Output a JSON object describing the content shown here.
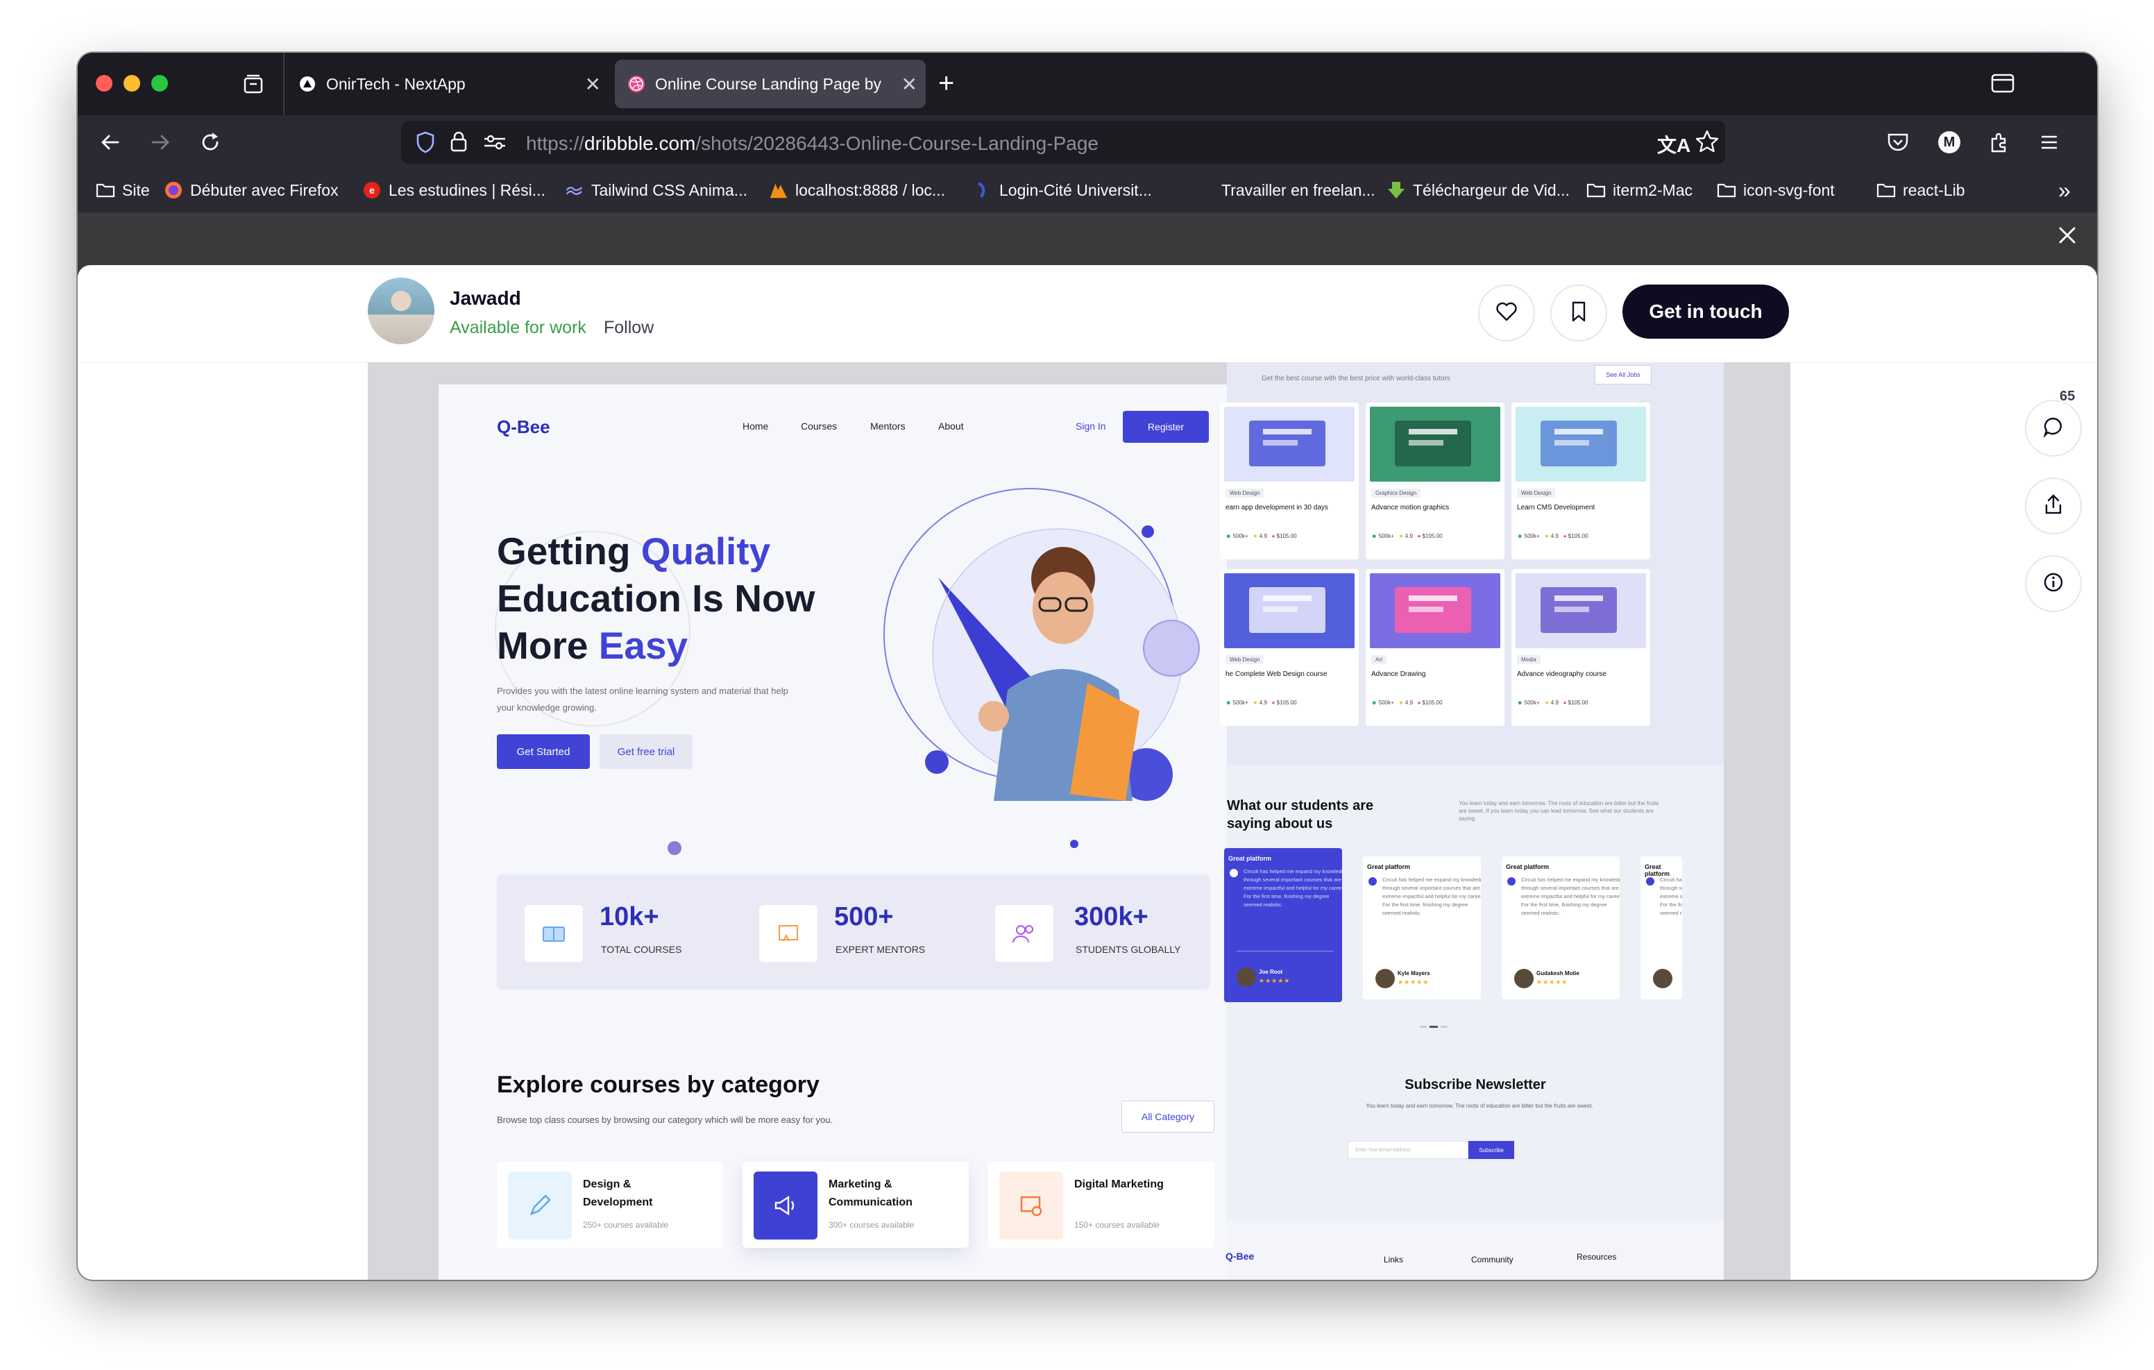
{
  "browser": {
    "tabs": [
      {
        "title": "OnirTech - NextApp",
        "active": false
      },
      {
        "title": "Online Course Landing Page by",
        "active": true
      }
    ],
    "url": {
      "scheme": "https://",
      "domain": "dribbble.com",
      "path": "/shots/20286443-Online-Course-Landing-Page"
    },
    "bookmarks": [
      {
        "label": "Site",
        "icon": "folder-icon"
      },
      {
        "label": "Débuter avec Firefox",
        "icon": "firefox-icon"
      },
      {
        "label": "Les estudines | Rési...",
        "icon": "estudines-icon"
      },
      {
        "label": "Tailwind CSS Anima...",
        "icon": "tailwind-icon"
      },
      {
        "label": "localhost:8888 / loc...",
        "icon": "phpmyadmin-icon"
      },
      {
        "label": "Login-Cité Universit...",
        "icon": "cite-icon"
      },
      {
        "label": "Travailler en freelan...",
        "icon": "malt-icon"
      },
      {
        "label": "Téléchargeur de Vid...",
        "icon": "download-icon"
      },
      {
        "label": "iterm2-Mac",
        "icon": "folder-icon"
      },
      {
        "label": "icon-svg-font",
        "icon": "folder-icon"
      },
      {
        "label": "react-Lib",
        "icon": "folder-icon"
      }
    ],
    "profile_initial": "M"
  },
  "shot_header": {
    "designer": "Jawadd",
    "availability": "Available for work",
    "follow": "Follow",
    "cta": "Get in touch",
    "comment_count": "65"
  },
  "landing": {
    "logo": "Q-Bee",
    "nav": [
      "Home",
      "Courses",
      "Mentors",
      "About"
    ],
    "sign_in": "Sign In",
    "register": "Register",
    "hero": {
      "line1a": "Getting ",
      "line1b": "Quality",
      "line2": "Education Is Now",
      "line3a": "More ",
      "line3b": "Easy",
      "subtitle": "Provides you with the latest online learning system and material that help your knowledge growing.",
      "get_started": "Get Started",
      "free_trial": "Get free trial"
    },
    "stats": [
      {
        "value": "10k+",
        "label": "TOTAL COURSES",
        "icon": "book-icon",
        "color": "#60a5fa"
      },
      {
        "value": "500+",
        "label": "EXPERT MENTORS",
        "icon": "certificate-icon",
        "color": "#f59e42"
      },
      {
        "value": "300k+",
        "label": "STUDENTS GLOBALLY",
        "icon": "users-icon",
        "color": "#a855f7"
      }
    ],
    "categories_title": "Explore courses by category",
    "categories_subtitle": "Browse top class courses by browsing our category which will be more easy for you.",
    "all_category": "All Category",
    "categories": [
      {
        "name": "Design & Development",
        "count": "250+ courses available",
        "icon": "pen-icon",
        "bg": "#e7f3fd",
        "fg": "#5aa7e8"
      },
      {
        "name": "Marketing & Communication",
        "count": "300+ courses available",
        "icon": "megaphone-icon",
        "bg": "#3f41d4",
        "fg": "#ffffff"
      },
      {
        "name": "Digital Marketing",
        "count": "150+ courses available",
        "icon": "marketing-icon",
        "bg": "#fdeee6",
        "fg": "#f07a3c"
      }
    ]
  },
  "right_panel": {
    "subtitle": "Get the best course with the best price with world-class tutors",
    "see_all": "See All Jobs",
    "courses": [
      {
        "tag": "Web Design",
        "title": "earn app development in 30 days",
        "bg": "#dfe3fb",
        "accent": "#4b54d8"
      },
      {
        "tag": "Graphics Design",
        "title": "Advance motion graphics",
        "bg": "#3d9b73",
        "accent": "#1e5e47"
      },
      {
        "tag": "Web Design",
        "title": "Learn CMS Development",
        "bg": "#c9eef2",
        "accent": "#5a86d8"
      },
      {
        "tag": "Web Design",
        "title": "he Complete Web Design course",
        "bg": "#5360dc",
        "accent": "#e9eafc"
      },
      {
        "tag": "Art",
        "title": "Advance Drawing",
        "bg": "#7b6ee4",
        "accent": "#ff5ea8"
      },
      {
        "tag": "Media",
        "title": "Advance videography course",
        "bg": "#dfe0f8",
        "accent": "#6d5bd0"
      }
    ],
    "course_meta": {
      "students": "500k+",
      "rating": "4.9",
      "price": "$105.00"
    },
    "testimonial_title": "What our students are saying about us",
    "testimonial_intro": "You learn today and earn tomorrow. The roots of education are bitter but the fruits are sweet. If you learn today you can lead tomorrow. See what our students are saying.",
    "testimonials": [
      {
        "title": "Great platform",
        "name": "Joe Root",
        "active": true
      },
      {
        "title": "Great platform",
        "name": "Kyle Mayers",
        "active": false
      },
      {
        "title": "Great platform",
        "name": "Gudakesh Motie",
        "active": false
      },
      {
        "title": "Great platform",
        "name": "",
        "active": false
      }
    ],
    "testimonial_body": "Circuit has helped me expand my knowledge through several important courses that are extreme impactful and helpful for my career. For the first time, finishing my degree seemed realistic.",
    "stars": "★★★★★",
    "newsletter_title": "Subscribe Newsletter",
    "newsletter_text": "You learn today and earn tomorrow. The roots of education are bitter but the fruits are sweet.",
    "newsletter_placeholder": "Enter Your Email Address",
    "subscribe": "Subscribe",
    "footer_logo": "Q-Bee",
    "footer_cols": [
      "Links",
      "Community",
      "Resources"
    ]
  }
}
